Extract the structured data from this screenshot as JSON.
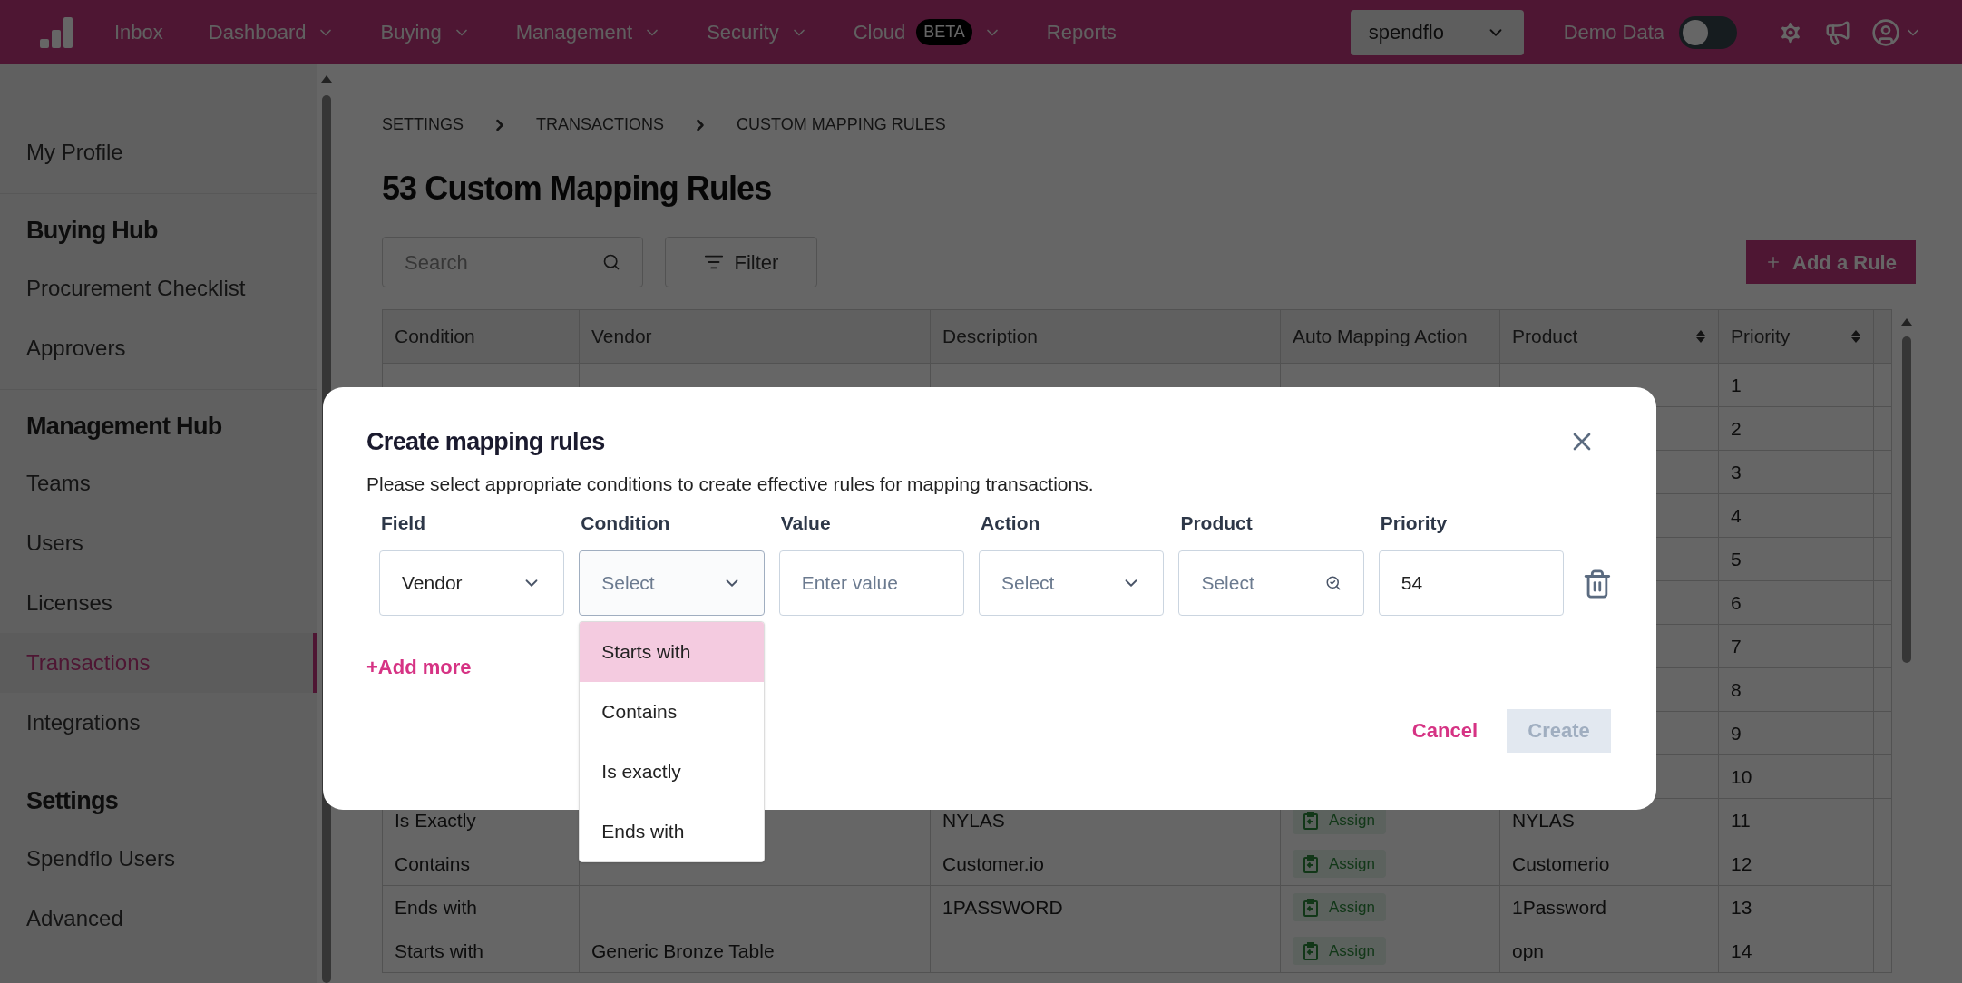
{
  "nav": {
    "items": [
      {
        "label": "Inbox",
        "dropdown": false
      },
      {
        "label": "Dashboard",
        "dropdown": true
      },
      {
        "label": "Buying",
        "dropdown": true
      },
      {
        "label": "Management",
        "dropdown": true
      },
      {
        "label": "Security",
        "dropdown": true
      },
      {
        "label": "Cloud",
        "dropdown": true,
        "badge": "BETA"
      },
      {
        "label": "Reports",
        "dropdown": false
      }
    ],
    "org_select": {
      "value": "spendflo"
    },
    "demo_toggle": {
      "label": "Demo Data",
      "on": false
    }
  },
  "sidebar": {
    "sections": [
      {
        "items": [
          {
            "label": "My Profile",
            "selected": false
          }
        ]
      },
      {
        "title": "Buying Hub",
        "items": [
          {
            "label": "Procurement Checklist",
            "selected": false
          },
          {
            "label": "Approvers",
            "selected": false
          }
        ]
      },
      {
        "title": "Management Hub",
        "items": [
          {
            "label": "Teams",
            "selected": false
          },
          {
            "label": "Users",
            "selected": false
          },
          {
            "label": "Licenses",
            "selected": false
          },
          {
            "label": "Transactions",
            "selected": true
          },
          {
            "label": "Integrations",
            "selected": false
          }
        ]
      },
      {
        "title": "Settings",
        "items": [
          {
            "label": "Spendflo Users",
            "selected": false
          },
          {
            "label": "Advanced",
            "selected": false
          }
        ]
      }
    ]
  },
  "breadcrumb": [
    "SETTINGS",
    "TRANSACTIONS",
    "CUSTOM MAPPING RULES"
  ],
  "title": "53 Custom Mapping Rules",
  "search": {
    "placeholder": "Search"
  },
  "filter_button": "Filter",
  "add_button": "Add a Rule",
  "table": {
    "columns": [
      {
        "label": "Condition",
        "sortable": false
      },
      {
        "label": "Vendor",
        "sortable": false
      },
      {
        "label": "Description",
        "sortable": false
      },
      {
        "label": "Auto Mapping Action",
        "sortable": false
      },
      {
        "label": "Product",
        "sortable": true
      },
      {
        "label": "Priority",
        "sortable": true
      }
    ],
    "rows": [
      {
        "priority": "1"
      },
      {
        "priority": "2"
      },
      {
        "priority": "3"
      },
      {
        "priority": "4"
      },
      {
        "priority": "5"
      },
      {
        "priority": "6"
      },
      {
        "priority": "7"
      },
      {
        "priority": "8"
      },
      {
        "priority": "9"
      },
      {
        "priority": "10"
      },
      {
        "condition": "Is Exactly",
        "description": "NYLAS",
        "action": "Assign",
        "product": "NYLAS",
        "priority": "11"
      },
      {
        "condition": "Contains",
        "description": "Customer.io",
        "action": "Assign",
        "product": "Customerio",
        "priority": "12"
      },
      {
        "condition": "Ends with",
        "description": "1PASSWORD",
        "action": "Assign",
        "product": "1Password",
        "priority": "13"
      },
      {
        "condition": "Starts with",
        "vendor": "Generic Bronze Table",
        "action": "Assign",
        "product": "opn",
        "priority": "14"
      }
    ]
  },
  "modal": {
    "title": "Create mapping rules",
    "description": "Please select appropriate conditions to create effective rules for mapping transactions.",
    "fields": [
      {
        "label": "Field",
        "kind": "select",
        "value": "Vendor"
      },
      {
        "label": "Condition",
        "kind": "select",
        "placeholder": "Select",
        "open": true
      },
      {
        "label": "Value",
        "kind": "input",
        "placeholder": "Enter value"
      },
      {
        "label": "Action",
        "kind": "select",
        "placeholder": "Select"
      },
      {
        "label": "Product",
        "kind": "search",
        "placeholder": "Select"
      },
      {
        "label": "Priority",
        "kind": "input",
        "value": "54"
      }
    ],
    "dropdown_options": [
      {
        "label": "Starts with",
        "selected": true
      },
      {
        "label": "Contains",
        "selected": false
      },
      {
        "label": "Is exactly",
        "selected": false
      },
      {
        "label": "Ends with",
        "selected": false
      }
    ],
    "add_more": "+Add more",
    "cancel": "Cancel",
    "create": {
      "label": "Create",
      "disabled": true
    }
  }
}
